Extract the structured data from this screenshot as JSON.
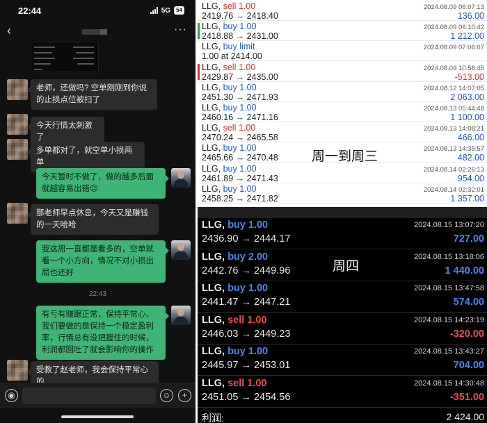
{
  "status_bar": {
    "time": "22:44",
    "network": "5G",
    "battery": "54"
  },
  "chat": {
    "back_glyph": "‹",
    "more_glyph": "···",
    "messages": [
      {
        "dir": "in",
        "text": "老师，还做吗? 空单刚刚到你说的止损点位被扫了"
      },
      {
        "dir": "in",
        "text": "今天行情太刺激了"
      },
      {
        "dir": "in",
        "text": "多单都对了，就空单小损两单"
      },
      {
        "dir": "out",
        "text": "今天暂时不做了，做的越多后面就越容易出错😔"
      },
      {
        "dir": "in",
        "text": "那老师早点休息，今天又是赚钱的一天哈哈"
      },
      {
        "dir": "out",
        "text": "我这周一直都是看多的，空单就看一个小方向，情况不对小损出局也还好"
      },
      {
        "dir": "out",
        "text": "有亏有赚跟正常，保持平常心，我们要做的是保持一个稳定盈利率，行情总有没把握住的时候，利润都回吐了就会影响你的操作"
      },
      {
        "dir": "in",
        "text": "受教了赵老师，我会保持平常心的"
      }
    ],
    "timestamp": "22:43",
    "input_placeholder": "",
    "voice_glyph": "◉",
    "emoji_glyph": "☺",
    "plus_glyph": "+"
  },
  "colors": {
    "buy": "#1a56db",
    "sell": "#d9302c",
    "profit_pos_light": "#1a56db",
    "profit_neg": "#d9302c",
    "dark_buy": "#4a86f0",
    "dark_sell": "#ef4b4b",
    "chat_out": "#3eb575"
  },
  "trades_light": [
    {
      "symbol": "LLG,",
      "side": "sell",
      "vol": "1.00",
      "prices": "2419.76 → 2418.40",
      "time": "2024.08.09 06:07:13",
      "pl": "136.00",
      "bar": ""
    },
    {
      "symbol": "LLG,",
      "side": "buy",
      "vol": "1.00",
      "prices": "2418.88 → 2431.00",
      "time": "2024.08.09 06:10:42",
      "pl": "1 212.00",
      "bar": "#2aa24a"
    },
    {
      "symbol": "LLG,",
      "side": "buy limit",
      "vol": "",
      "prices": "1.00 at 2414.00",
      "time": "2024.08.09 07:06:07",
      "pl": "",
      "bar": ""
    },
    {
      "symbol": "LLG,",
      "side": "sell",
      "vol": "1.00",
      "prices": "2429.87 → 2435.00",
      "time": "2024.08.09 10:58:45",
      "pl": "-513.00",
      "bar": "#d9302c"
    },
    {
      "symbol": "LLG,",
      "side": "buy",
      "vol": "1.00",
      "prices": "2451.30 → 2471.93",
      "time": "2024.08.12 14:07:05",
      "pl": "2 063.00",
      "bar": ""
    },
    {
      "symbol": "LLG,",
      "side": "buy",
      "vol": "1.00",
      "prices": "2460.16 → 2471.16",
      "time": "2024.08.13 05:44:48",
      "pl": "1 100.00",
      "bar": ""
    },
    {
      "symbol": "LLG,",
      "side": "sell",
      "vol": "1.00",
      "prices": "2470.24 → 2465.58",
      "time": "2024.08.13 14:08:21",
      "pl": "466.00",
      "bar": ""
    },
    {
      "symbol": "LLG,",
      "side": "buy",
      "vol": "1.00",
      "prices": "2465.66 → 2470.48",
      "time": "2024.08.13 14:35:57",
      "pl": "482.00",
      "bar": ""
    },
    {
      "symbol": "LLG,",
      "side": "buy",
      "vol": "1.00",
      "prices": "2461.89 → 2471.43",
      "time": "2024.08.14 02:26:13",
      "pl": "954.00",
      "bar": ""
    },
    {
      "symbol": "LLG,",
      "side": "buy",
      "vol": "1.00",
      "prices": "2458.25 → 2471.82",
      "time": "2024.08.14 02:32:01",
      "pl": "1 357.00",
      "bar": ""
    }
  ],
  "overlay_light": "周一到周三",
  "overlay_dark": "周四",
  "trades_dark": [
    {
      "symbol": "LLG,",
      "side": "buy",
      "vol": "1.00",
      "prices": "2436.90 → 2444.17",
      "time": "2024.08.15 13:07:20",
      "pl": "727.00"
    },
    {
      "symbol": "LLG,",
      "side": "buy",
      "vol": "2.00",
      "prices": "2442.76 → 2449.96",
      "time": "2024.08.15 13:18:06",
      "pl": "1 440.00"
    },
    {
      "symbol": "LLG,",
      "side": "buy",
      "vol": "1.00",
      "prices": "2441.47 → 2447.21",
      "time": "2024.08.15 13:47:58",
      "pl": "574.00"
    },
    {
      "symbol": "LLG,",
      "side": "sell",
      "vol": "1.00",
      "prices": "2446.03 → 2449.23",
      "time": "2024.08.15 14:23:19",
      "pl": "-320.00"
    },
    {
      "symbol": "LLG,",
      "side": "buy",
      "vol": "1.00",
      "prices": "2445.97 → 2453.01",
      "time": "2024.08.15 13:43:27",
      "pl": "704.00"
    },
    {
      "symbol": "LLG,",
      "side": "sell",
      "vol": "1.00",
      "prices": "2451.05 → 2454.56",
      "time": "2024.08.15 14:30:48",
      "pl": "-351.00"
    }
  ],
  "profit": {
    "label": "利润:",
    "value": "2 424.00"
  }
}
